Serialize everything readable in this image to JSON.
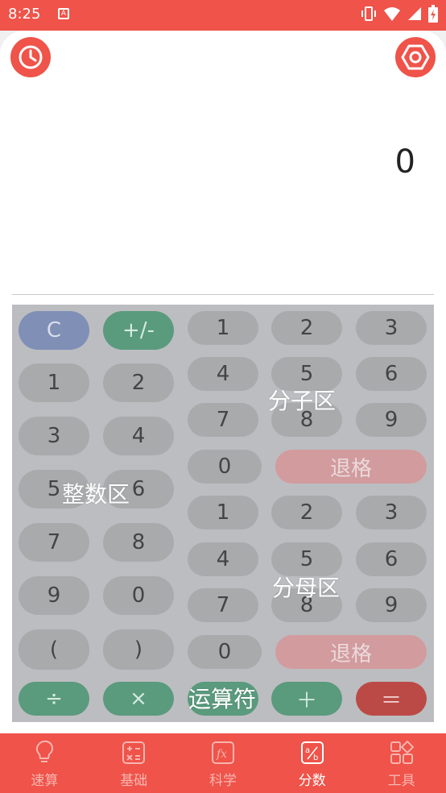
{
  "status": {
    "time": "8:25",
    "app_badge": "A"
  },
  "display": {
    "value": "0"
  },
  "keypad": {
    "integer": {
      "rows": [
        [
          "C",
          "+/-"
        ],
        [
          "1",
          "2"
        ],
        [
          "3",
          "4"
        ],
        [
          "5",
          "6"
        ],
        [
          "7",
          "8"
        ],
        [
          "9",
          "0"
        ],
        [
          "(",
          ")"
        ]
      ],
      "label": "整数区"
    },
    "numerator": {
      "rows": [
        [
          "1",
          "2",
          "3"
        ],
        [
          "4",
          "5",
          "6"
        ],
        [
          "7",
          "8",
          "9"
        ]
      ],
      "zero": "0",
      "backspace": "退格",
      "label": "分子区"
    },
    "denominator": {
      "rows": [
        [
          "1",
          "2",
          "3"
        ],
        [
          "4",
          "5",
          "6"
        ],
        [
          "7",
          "8",
          "9"
        ]
      ],
      "zero": "0",
      "backspace": "退格",
      "label": "分母区"
    },
    "operators": {
      "divide": "÷",
      "multiply": "×",
      "minus": "－",
      "plus": "＋",
      "equals": "＝",
      "label": "运算符"
    }
  },
  "tabs": [
    {
      "label": "速算",
      "icon": "lightbulb-icon"
    },
    {
      "label": "基础",
      "icon": "calculator-icon"
    },
    {
      "label": "科学",
      "icon": "function-icon"
    },
    {
      "label": "分数",
      "icon": "fraction-icon",
      "active": true
    },
    {
      "label": "工具",
      "icon": "tools-icon"
    }
  ],
  "colors": {
    "accent": "#ef5349",
    "keypad_bg": "#bcbdc0"
  }
}
